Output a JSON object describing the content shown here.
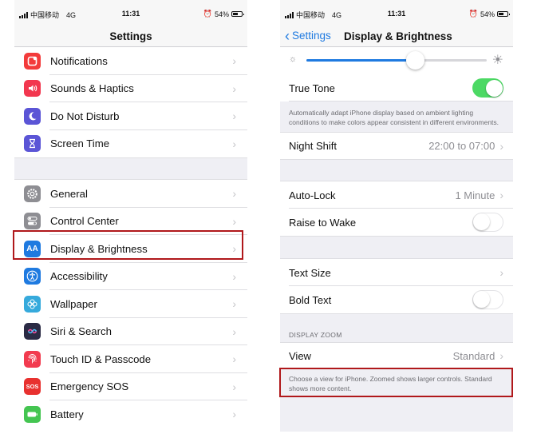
{
  "status_bar": {
    "carrier": "中国移动",
    "network": "4G",
    "time": "11:31",
    "battery": "54%"
  },
  "left_screen": {
    "title": "Settings",
    "group1": [
      {
        "label": "Notifications",
        "icon": "notifications-icon",
        "color": "#f33b3b"
      },
      {
        "label": "Sounds & Haptics",
        "icon": "speaker-icon",
        "color": "#f2374f"
      },
      {
        "label": "Do Not Disturb",
        "icon": "moon-icon",
        "color": "#5b55d6"
      },
      {
        "label": "Screen Time",
        "icon": "hourglass-icon",
        "color": "#5b55d6"
      }
    ],
    "group2": [
      {
        "label": "General",
        "icon": "gear-icon",
        "color": "#8e8e93"
      },
      {
        "label": "Control Center",
        "icon": "toggles-icon",
        "color": "#8e8e93"
      },
      {
        "label": "Display & Brightness",
        "icon": "display-aa-icon",
        "color": "#1f7ae0",
        "glyph": "AA"
      },
      {
        "label": "Accessibility",
        "icon": "accessibility-icon",
        "color": "#1f7ae0"
      },
      {
        "label": "Wallpaper",
        "icon": "wallpaper-flower-icon",
        "color": "#36aadc"
      },
      {
        "label": "Siri & Search",
        "icon": "siri-icon",
        "color": "#2b2b45"
      },
      {
        "label": "Touch ID & Passcode",
        "icon": "fingerprint-icon",
        "color": "#f23b4f"
      },
      {
        "label": "Emergency SOS",
        "icon": "sos-icon",
        "color": "#e8312f",
        "glyph": "SOS"
      },
      {
        "label": "Battery",
        "icon": "battery-icon",
        "color": "#44c551"
      }
    ]
  },
  "right_screen": {
    "back_label": "Settings",
    "title": "Display & Brightness",
    "brightness_level": 0.6,
    "true_tone": {
      "label": "True Tone",
      "on": true
    },
    "true_tone_note": "Automatically adapt iPhone display based on ambient lighting conditions to make colors appear consistent in different environments.",
    "night_shift": {
      "label": "Night Shift",
      "value": "22:00 to 07:00"
    },
    "auto_lock": {
      "label": "Auto-Lock",
      "value": "1 Minute"
    },
    "raise_to_wake": {
      "label": "Raise to Wake",
      "on": false
    },
    "text_size": {
      "label": "Text Size"
    },
    "bold_text": {
      "label": "Bold Text",
      "on": false
    },
    "display_zoom_header": "DISPLAY ZOOM",
    "view": {
      "label": "View",
      "value": "Standard"
    },
    "view_note": "Choose a view for iPhone. Zoomed shows larger controls. Standard shows more content."
  },
  "colors": {
    "highlight": "#b0181b",
    "accent": "#1f7ae0",
    "toggle_on": "#4cd964"
  }
}
